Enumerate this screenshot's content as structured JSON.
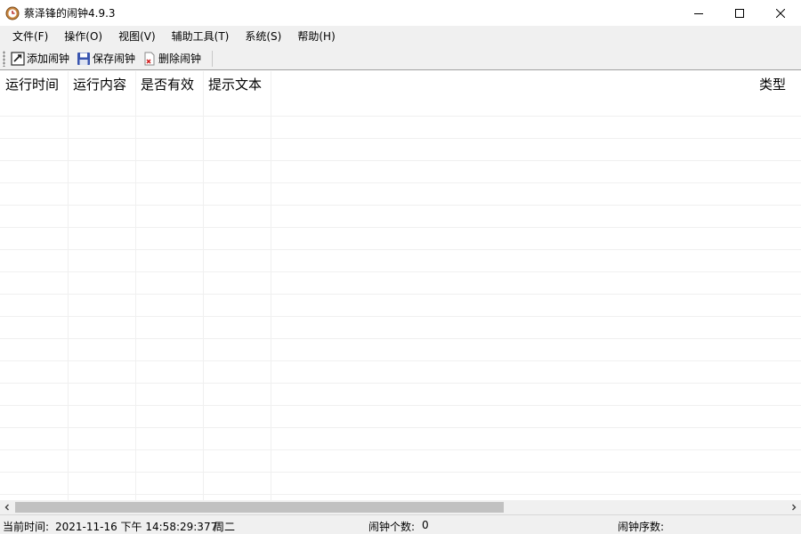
{
  "window": {
    "title": "蔡泽锋的闹钟4.9.3",
    "controls": {
      "minimize": "minimize",
      "maximize": "maximize",
      "close": "close"
    }
  },
  "menu": {
    "items": [
      "文件(F)",
      "操作(O)",
      "视图(V)",
      "辅助工具(T)",
      "系统(S)",
      "帮助(H)"
    ]
  },
  "toolbar": {
    "add_label": "添加闹钟",
    "save_label": "保存闹钟",
    "delete_label": "删除闹钟"
  },
  "list": {
    "columns": [
      "运行时间",
      "运行内容",
      "是否有效",
      "提示文本",
      "类型"
    ]
  },
  "status": {
    "current_time_label": "当前时间:",
    "current_time_value": "2021-11-16 下午 14:58:29:377",
    "weekday": "周二",
    "count_label": "闹钟个数:",
    "count_value": "0",
    "index_label": "闹钟序数:"
  },
  "colors": {
    "chrome": "#f0f0f0",
    "grid": "#f0f0f0",
    "scroll_thumb": "#c1c1c1"
  }
}
